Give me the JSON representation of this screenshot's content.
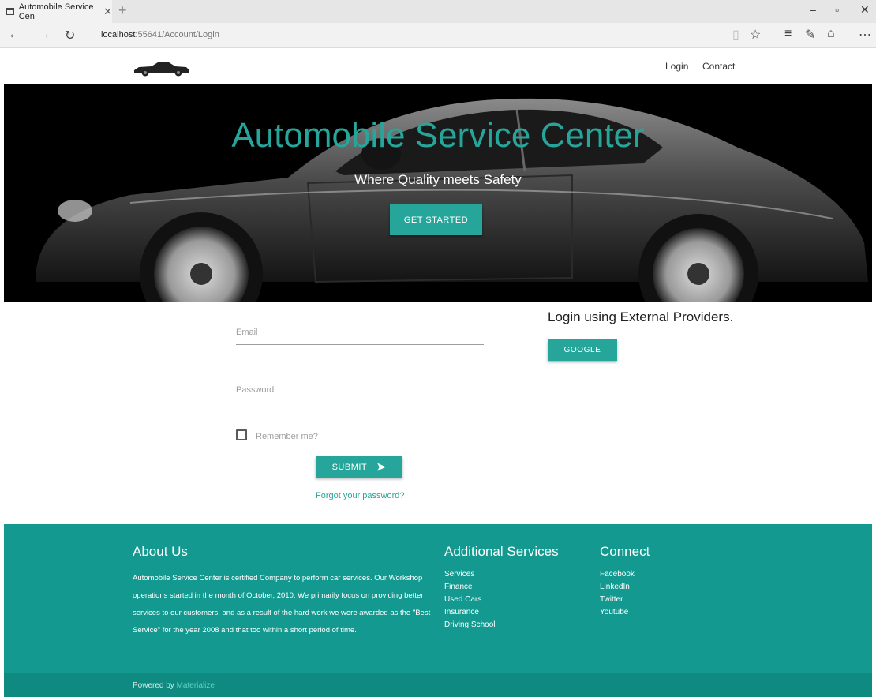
{
  "browser": {
    "tab_title": "Automobile Service Cen",
    "url_host": "localhost",
    "url_rest": ":55641/Account/Login"
  },
  "header": {
    "nav": [
      "Login",
      "Contact"
    ]
  },
  "hero": {
    "title": "Automobile Service Center",
    "subtitle": "Where Quality meets Safety",
    "cta": "GET STARTED"
  },
  "login": {
    "email_label": "Email",
    "password_label": "Password",
    "remember_label": "Remember me?",
    "submit_label": "SUBMIT",
    "forgot_label": "Forgot your password?"
  },
  "external": {
    "title": "Login using External Providers.",
    "google_label": "GOOGLE"
  },
  "footer": {
    "about_title": "About Us",
    "about_text": "Automobile Service Center is certified Company to perform car services. Our Workshop operations started in the month of October, 2010. We primarily focus on providing better services to our customers, and as a result of the hard work we were awarded as the \"Best Service\" for the year 2008 and that too within a short period of time.",
    "services_title": "Additional Services",
    "services": [
      "Services",
      "Finance",
      "Used Cars",
      "Insurance",
      "Driving School"
    ],
    "connect_title": "Connect",
    "connect": [
      "Facebook",
      "LinkedIn",
      "Twitter",
      "Youtube"
    ],
    "powered_prefix": "Powered by ",
    "powered_link": "Materialize"
  },
  "colors": {
    "accent": "#26a69a",
    "footer_bg": "#13998f",
    "footer_bottom": "#0f8a80"
  }
}
